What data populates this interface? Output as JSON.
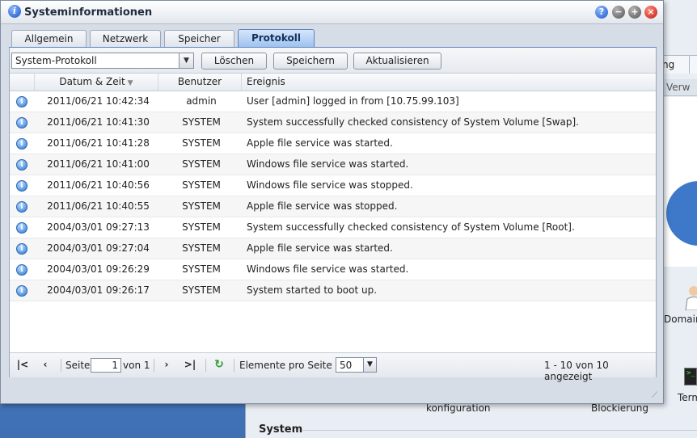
{
  "window": {
    "title": "Systeminformationen",
    "buttons": [
      "?",
      "−",
      "+",
      "×"
    ]
  },
  "tabs": [
    {
      "label": "Allgemein",
      "active": false
    },
    {
      "label": "Netzwerk",
      "active": false
    },
    {
      "label": "Speicher",
      "active": false
    },
    {
      "label": "Protokoll",
      "active": true
    }
  ],
  "toolbar": {
    "log_select": "System-Protokoll",
    "delete_label": "Löschen",
    "save_label": "Speichern",
    "refresh_label": "Aktualisieren"
  },
  "table": {
    "columns": {
      "date": "Datum & Zeit",
      "user": "Benutzer",
      "event": "Ereignis"
    },
    "rows": [
      {
        "date": "2011/06/21 10:42:34",
        "user": "admin",
        "event": "User [admin] logged in from [10.75.99.103]"
      },
      {
        "date": "2011/06/21 10:41:30",
        "user": "SYSTEM",
        "event": "System successfully checked consistency of System Volume [Swap]."
      },
      {
        "date": "2011/06/21 10:41:28",
        "user": "SYSTEM",
        "event": "Apple file service was started."
      },
      {
        "date": "2011/06/21 10:41:00",
        "user": "SYSTEM",
        "event": "Windows file service was started."
      },
      {
        "date": "2011/06/21 10:40:56",
        "user": "SYSTEM",
        "event": "Windows file service was stopped."
      },
      {
        "date": "2011/06/21 10:40:55",
        "user": "SYSTEM",
        "event": "Apple file service was stopped."
      },
      {
        "date": "2004/03/01 09:27:13",
        "user": "SYSTEM",
        "event": "System successfully checked consistency of System Volume [Root]."
      },
      {
        "date": "2004/03/01 09:27:04",
        "user": "SYSTEM",
        "event": "Apple file service was started."
      },
      {
        "date": "2004/03/01 09:26:29",
        "user": "SYSTEM",
        "event": "Windows file service was started."
      },
      {
        "date": "2004/03/01 09:26:17",
        "user": "SYSTEM",
        "event": "System started to boot up."
      }
    ]
  },
  "pager": {
    "page_label": "Seite",
    "page_value": "1",
    "of_label": "von 1",
    "per_page_label": "Elemente pro Seite :",
    "per_page_value": "50",
    "summary": "1 - 10 von 10 angezeigt"
  },
  "background": {
    "tab1": "ng",
    "header": "Verw",
    "label_domain": "Domain",
    "label_term": "Term",
    "label_konfig": "konfiguration",
    "label_block": "Blockierung",
    "section_system": "System"
  },
  "colors": {
    "accent": "#5a84c0",
    "active_tab": "#9dc1ef",
    "close": "#c21b10"
  }
}
